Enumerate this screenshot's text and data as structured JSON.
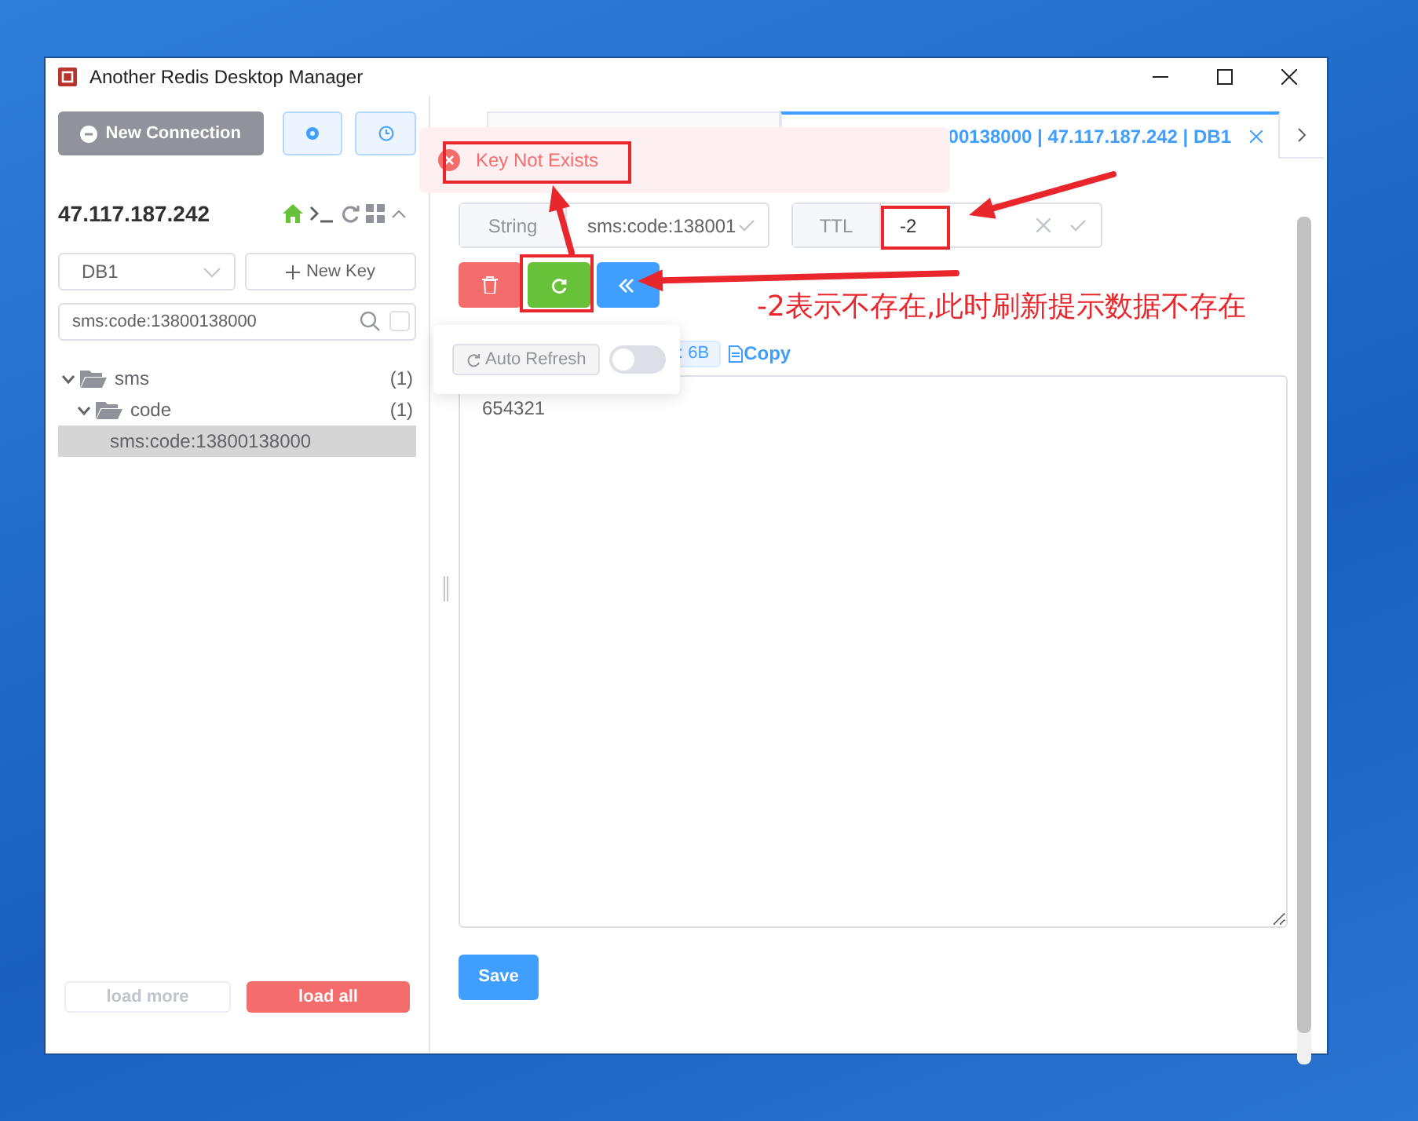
{
  "window": {
    "title": "Another Redis Desktop Manager"
  },
  "sidebar": {
    "new_connection": "New Connection",
    "host": "47.117.187.242",
    "db_select": "DB1",
    "new_key": "New Key",
    "search": "sms:code:13800138000",
    "tree": [
      {
        "label": "sms",
        "count": "(1)",
        "expanded": true,
        "children": [
          {
            "label": "code",
            "count": "(1)",
            "expanded": true,
            "children": [
              {
                "label": "sms:code:13800138000",
                "selected": true
              }
            ]
          }
        ]
      }
    ],
    "load_more": {
      "label": "load more",
      "disabled": true
    },
    "load_all": {
      "label": "load all",
      "disabled": false
    }
  },
  "tabs": [
    {
      "selected": false
    },
    {
      "label": "00138000 | 47.117.187.242 | DB1",
      "selected": true
    }
  ],
  "toast": {
    "message": "Key Not Exists"
  },
  "key": {
    "type": "String",
    "name": "sms:code:138001",
    "ttl_label": "TTL",
    "ttl": "-2"
  },
  "popover": {
    "label": "Auto Refresh",
    "on": false
  },
  "size_tag": ": 6B",
  "copy": "Copy",
  "value": "654321",
  "save": "Save",
  "annotation": {
    "note": "-2表示不存在,此时刷新提示数据不存在"
  }
}
